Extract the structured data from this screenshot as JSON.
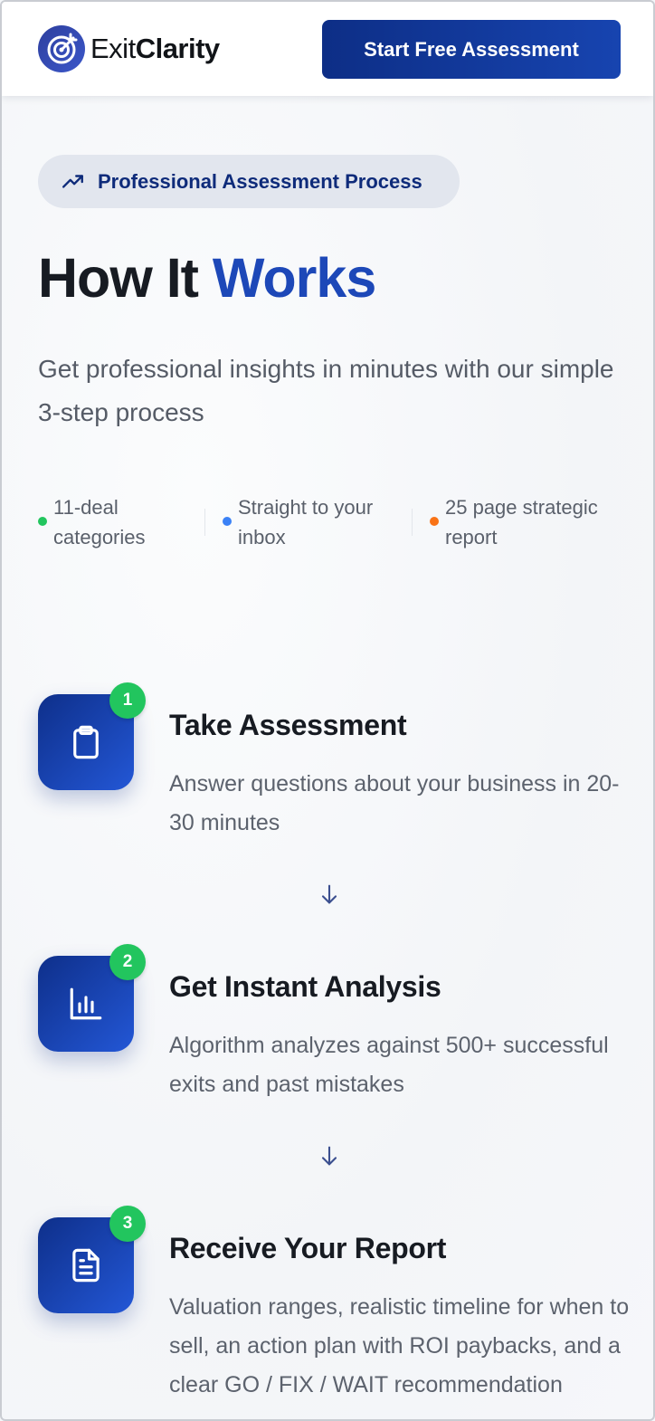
{
  "header": {
    "logo_text_regular": "Exit",
    "logo_text_bold": "Clarity",
    "cta_label": "Start Free Assessment"
  },
  "hero": {
    "pill_label": "Professional Assessment Process",
    "title_part1": "How It ",
    "title_part2": "Works",
    "subtitle": "Get professional insights in minutes with our simple 3-step process"
  },
  "stats": [
    {
      "line1": "11-deal",
      "line2": "categories",
      "color": "#22c55e"
    },
    {
      "line1": "Straight to your",
      "line2": "inbox",
      "color": "#3b82f6"
    },
    {
      "line1": "25 page strategic",
      "line2": "report",
      "color": "#f97316"
    }
  ],
  "steps": [
    {
      "number": "1",
      "title": "Take Assessment",
      "description": "Answer questions about your business in 20-30 minutes",
      "icon": "clipboard-icon"
    },
    {
      "number": "2",
      "title": "Get Instant Analysis",
      "description": "Algorithm analyzes against 500+ successful exits and past mistakes",
      "icon": "bar-chart-icon"
    },
    {
      "number": "3",
      "title": "Receive Your Report",
      "description": "Valuation ranges, realistic timeline for when to sell, an action plan with ROI paybacks, and a clear GO / FIX / WAIT recommendation",
      "icon": "document-icon"
    }
  ],
  "colors": {
    "brand": "#0e2b7a",
    "accent": "#1d48b8",
    "badge": "#22c55e"
  }
}
